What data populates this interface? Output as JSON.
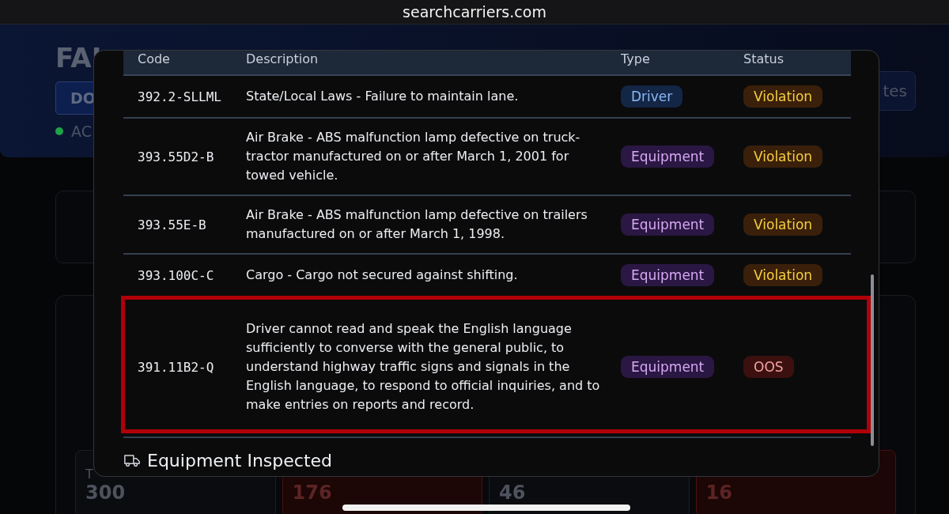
{
  "browser": {
    "address": "searchcarriers.com"
  },
  "background_page": {
    "title": "FAI",
    "tab_button": "DO",
    "status": {
      "label": "AC",
      "color": "#1fa34a"
    },
    "right_button": "tes",
    "stats": [
      {
        "label": "T",
        "value": "300",
        "kind": "plain"
      },
      {
        "value": "176",
        "kind": "alert"
      },
      {
        "value": "46",
        "kind": "plain"
      },
      {
        "value": "16",
        "kind": "alert"
      }
    ]
  },
  "modal": {
    "table": {
      "columns": [
        "Code",
        "Description",
        "Type",
        "Status"
      ],
      "rows": [
        {
          "code": "392.2-SLLML",
          "description": "State/Local Laws - Failure to maintain lane.",
          "type": {
            "label": "Driver",
            "kind": "driver"
          },
          "status": {
            "label": "Violation",
            "kind": "violation"
          },
          "highlighted": false
        },
        {
          "code": "393.55D2-B",
          "description": "Air Brake - ABS malfunction lamp defective on truck-tractor manufactured on or after March 1, 2001 for towed vehicle.",
          "type": {
            "label": "Equipment",
            "kind": "equipment"
          },
          "status": {
            "label": "Violation",
            "kind": "violation"
          },
          "highlighted": false
        },
        {
          "code": "393.55E-B",
          "description": "Air Brake - ABS malfunction lamp defective on trailers manufactured on or after March 1, 1998.",
          "type": {
            "label": "Equipment",
            "kind": "equipment"
          },
          "status": {
            "label": "Violation",
            "kind": "violation"
          },
          "highlighted": false
        },
        {
          "code": "393.100C-C",
          "description": "Cargo - Cargo not secured against shifting.",
          "type": {
            "label": "Equipment",
            "kind": "equipment"
          },
          "status": {
            "label": "Violation",
            "kind": "violation"
          },
          "highlighted": false
        },
        {
          "code": "391.11B2-Q",
          "description": "Driver cannot read and speak the English language sufficiently to converse with the general public, to understand highway traffic signs and signals in the English language, to respond to official inquiries, and to make entries on reports and record.",
          "type": {
            "label": "Equipment",
            "kind": "equipment"
          },
          "status": {
            "label": "OOS",
            "kind": "oos"
          },
          "highlighted": true
        }
      ]
    },
    "section_heading": "Equipment Inspected"
  }
}
